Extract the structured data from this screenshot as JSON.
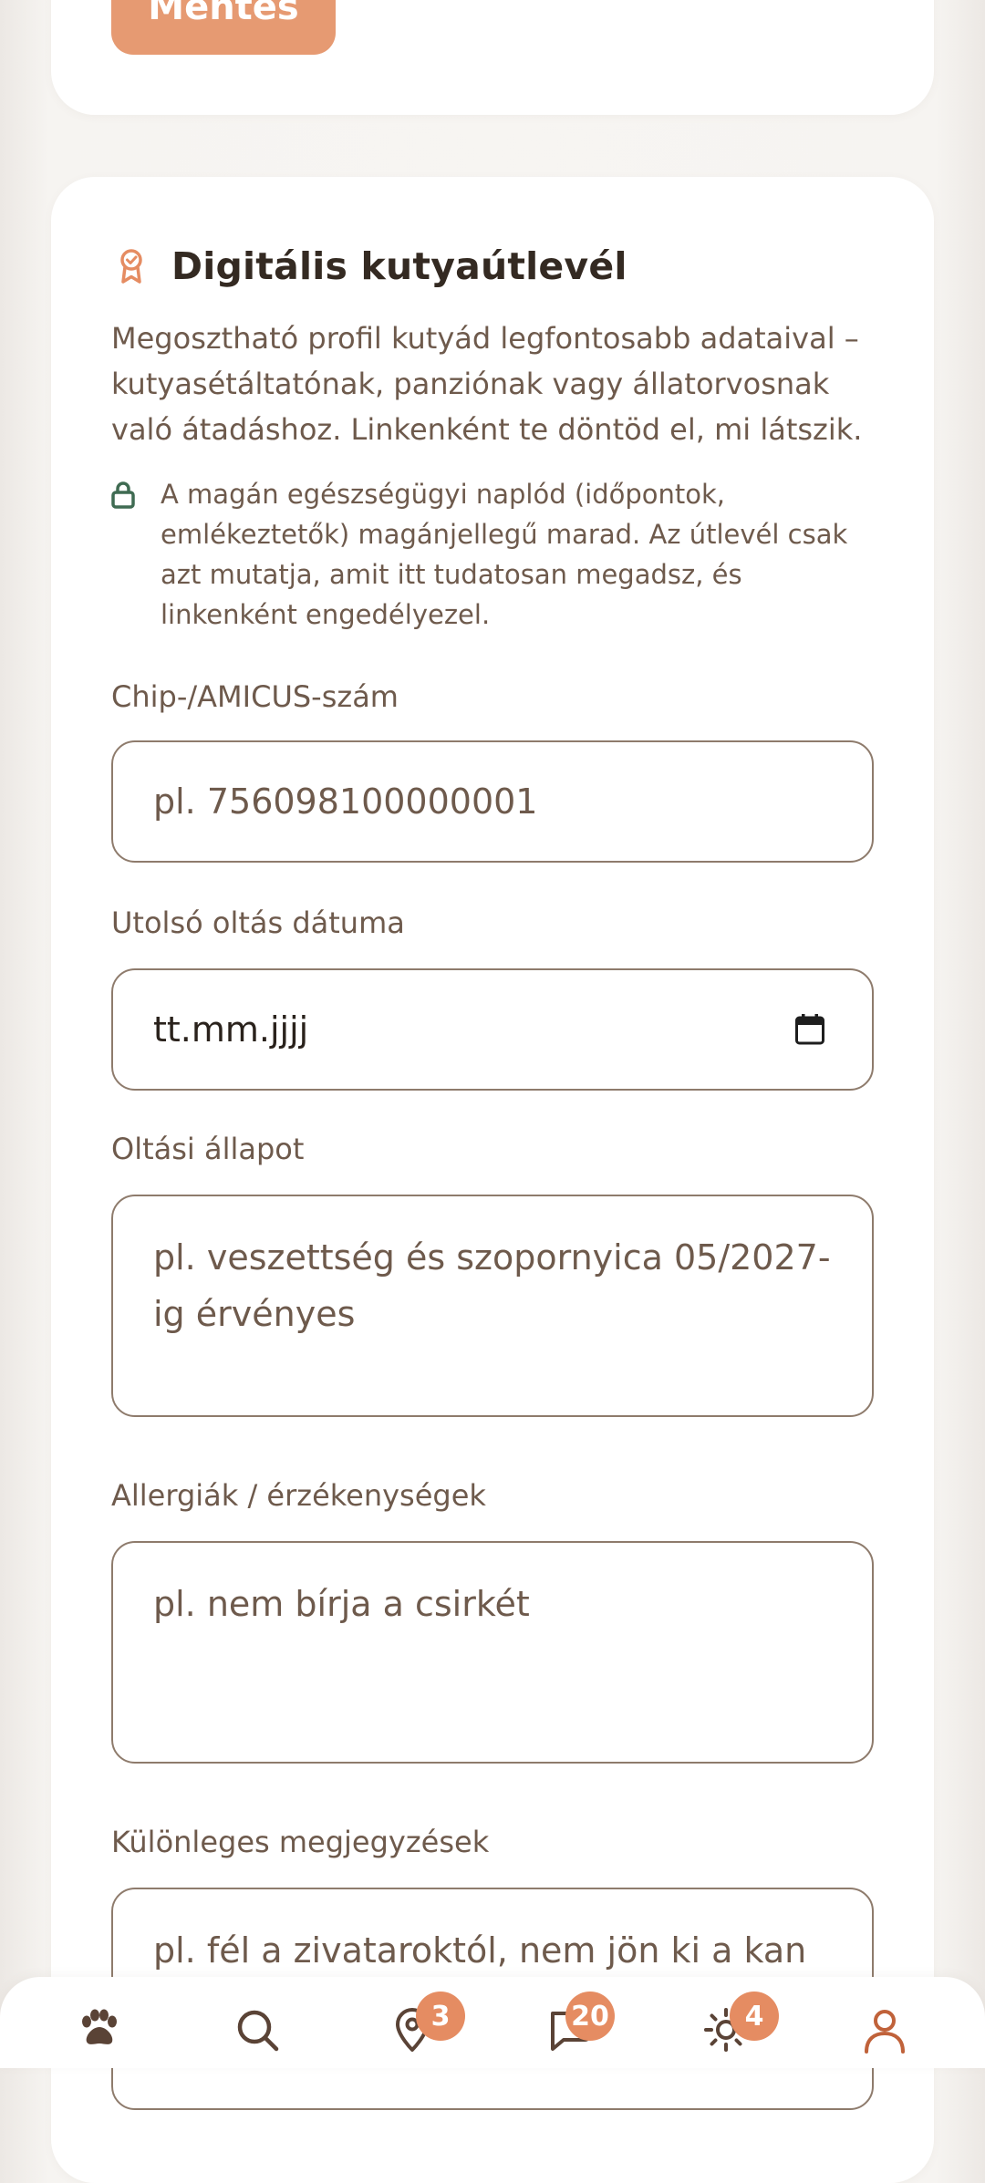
{
  "top_card": {
    "save_button_label": "Mentés"
  },
  "passport": {
    "title": "Digitális kutyaútlevél",
    "title_icon": "badge-award-icon",
    "intro": "Megosztható profil kutyád legfontosabb adataival – kutyasétáltatónak, panziónak vagy állatorvosnak való átadáshoz. Linkenként te döntöd el, mi látszik.",
    "privacy_icon": "lock-icon",
    "privacy_note": "A magán egészségügyi naplód (időpontok, emlékeztetők) magánjellegű marad. Az útlevél csak azt mutatja, amit itt tudatosan megadsz, és linkenként engedélyezel.",
    "fields": {
      "chip": {
        "label": "Chip-/AMICUS-szám",
        "placeholder": "pl. 756098100000001"
      },
      "vaccination_date": {
        "label": "Utolsó oltás dátuma",
        "placeholder": "tt.mm.jjjj",
        "icon": "calendar-icon"
      },
      "vaccination_status": {
        "label": "Oltási állapot",
        "placeholder": "pl. veszettség és szopornyica 05/2027-ig érvényes"
      },
      "allergies": {
        "label": "Allergiák / érzékenységek",
        "placeholder": "pl. nem bírja a csirkét"
      },
      "special_notes": {
        "label": "Különleges megjegyzések",
        "placeholder": "pl. fél a zivataroktól, nem jön ki a kan"
      }
    }
  },
  "bottom_nav": {
    "items": [
      {
        "icon": "paw-icon",
        "badge": ""
      },
      {
        "icon": "search-icon",
        "badge": ""
      },
      {
        "icon": "map-pin-icon",
        "badge": "3"
      },
      {
        "icon": "chat-bubble-icon",
        "badge": "20"
      },
      {
        "icon": "sun-icon",
        "badge": "4"
      },
      {
        "icon": "user-icon",
        "badge": ""
      }
    ]
  },
  "colors": {
    "accent": "#e69a72",
    "badge": "#e58c62",
    "text_primary": "#342a22",
    "text_secondary": "#6e5a4c",
    "border": "#8e7b6c",
    "nav_active": "#c0623a"
  }
}
